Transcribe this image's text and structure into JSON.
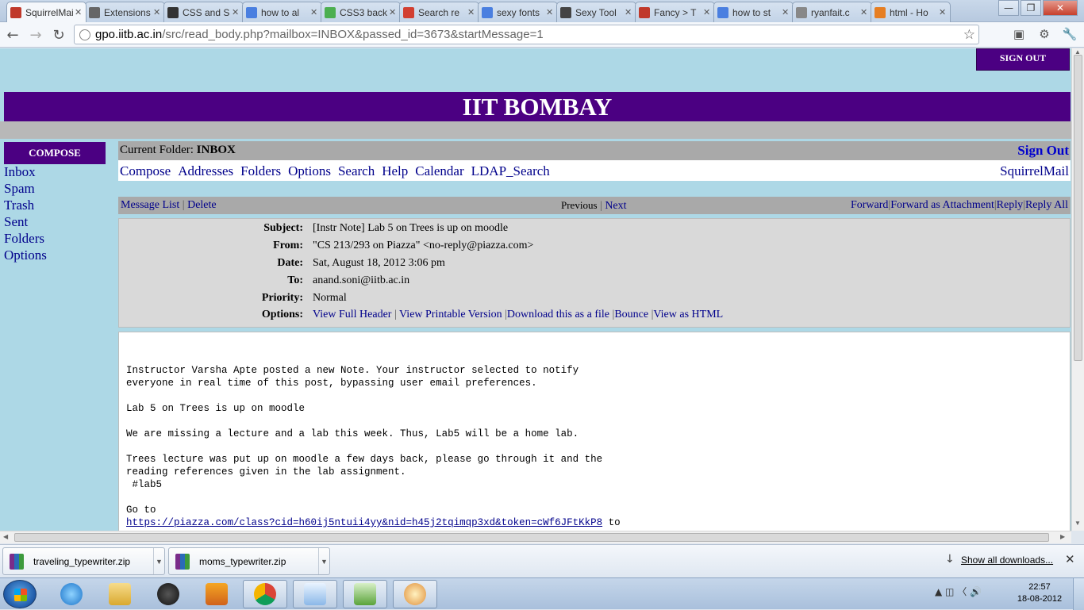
{
  "browser": {
    "tabs": [
      {
        "label": "SquirrelMail",
        "icon": "squirrelmail-icon",
        "active": true,
        "color": "#c0392b"
      },
      {
        "label": "Extensions",
        "icon": "puzzle-icon",
        "color": "#666666"
      },
      {
        "label": "CSS and S",
        "icon": "html-icon",
        "color": "#333333"
      },
      {
        "label": "how to al",
        "icon": "google-icon",
        "color": "#4a7fe0"
      },
      {
        "label": "CSS3 back",
        "icon": "css3-icon",
        "color": "#4caf50"
      },
      {
        "label": "Search re",
        "icon": "gmail-icon",
        "color": "#d23f31"
      },
      {
        "label": "sexy fonts",
        "icon": "google-icon",
        "color": "#4a7fe0"
      },
      {
        "label": "Sexy Tool",
        "icon": "sr-icon",
        "color": "#444444"
      },
      {
        "label": "Fancy > T",
        "icon": "fancy-icon",
        "color": "#c0392b"
      },
      {
        "label": "how to st",
        "icon": "google-icon",
        "color": "#4a7fe0"
      },
      {
        "label": "ryanfait.c",
        "icon": "globe-icon",
        "color": "#888888"
      },
      {
        "label": "html - Ho",
        "icon": "stack-icon",
        "color": "#e67e22"
      }
    ],
    "url_host": "gpo.iitb.ac.in",
    "url_path": "/src/read_body.php?mailbox=INBOX&passed_id=3673&startMessage=1"
  },
  "page": {
    "signout_top": "SIGN OUT",
    "banner": "IIT BOMBAY",
    "compose": "COMPOSE",
    "leftnav": [
      "Inbox",
      "Spam",
      "Trash",
      "Sent",
      "Folders",
      "Options"
    ],
    "current_folder_label": "Current Folder:",
    "current_folder": "INBOX",
    "sign_out": "Sign Out",
    "menu": [
      "Compose",
      "Addresses",
      "Folders",
      "Options",
      "Search",
      "Help",
      "Calendar",
      "LDAP_Search"
    ],
    "brand": "SquirrelMail",
    "msgnav": {
      "message_list": "Message List",
      "delete": "Delete",
      "previous": "Previous",
      "next": "Next",
      "forward": "Forward",
      "forward_attachment": "Forward as Attachment",
      "reply": "Reply",
      "reply_all": "Reply All"
    },
    "headers": [
      {
        "label": "Subject:",
        "value": "[Instr Note] Lab 5 on Trees is up on moodle"
      },
      {
        "label": "From:",
        "value": "\"CS 213/293 on Piazza\" <no-reply@piazza.com>"
      },
      {
        "label": "Date:",
        "value": "Sat, August 18, 2012 3:06 pm"
      },
      {
        "label": "To:",
        "value": "anand.soni@iitb.ac.in"
      },
      {
        "label": "Priority:",
        "value": "Normal"
      }
    ],
    "options_label": "Options:",
    "options": [
      "View Full Header",
      "View Printable Version",
      "Download this as a file",
      "Bounce",
      "View as HTML"
    ],
    "body_lines": [
      "Instructor Varsha Apte posted a new Note. Your instructor selected to notify",
      "everyone in real time of this post, bypassing user email preferences.",
      "",
      "Lab 5 on Trees is up on moodle",
      "",
      "We are missing a lecture and a lab this week. Thus, Lab5 will be a home lab.",
      "",
      "Trees lecture was put up on moodle a few days back, please go through it and the",
      "reading references given in the lab assignment.",
      " #lab5",
      "",
      "Go to"
    ],
    "body_link": "https://piazza.com/class?cid=h60ij5ntuii4yy&nid=h45j2tqimqp3xd&token=cWf6JFtKkP8",
    "body_link_tail": " to"
  },
  "downloads": {
    "items": [
      "traveling_typewriter.zip",
      "moms_typewriter.zip"
    ],
    "show_all": "Show all downloads..."
  },
  "taskbar": {
    "time": "22:57",
    "date": "18-08-2012"
  },
  "colors": {
    "page_bg": "#add8e6",
    "banner": "#4b0082",
    "link": "#00008b"
  }
}
